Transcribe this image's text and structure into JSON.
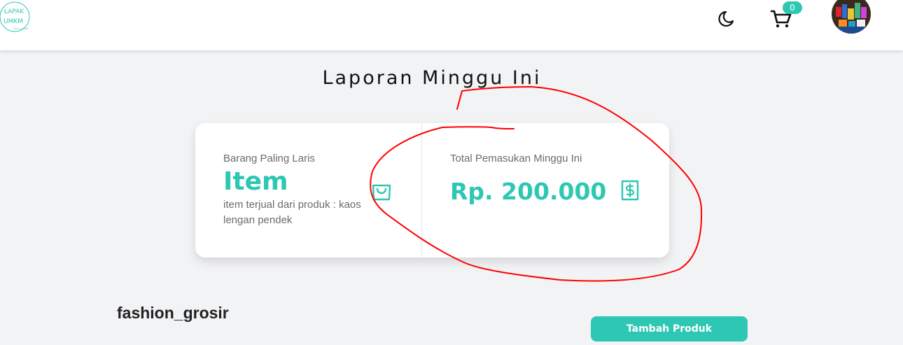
{
  "header": {
    "logo_text_line1": "LAPAK",
    "logo_text_line2": "UMKM",
    "logo_text_line3": "LOCAL STORE",
    "cart_count": "0",
    "icons": [
      "logo-icon",
      "moon-icon",
      "cart-icon",
      "avatar"
    ]
  },
  "report": {
    "title": "Laporan Minggu Ini",
    "best_seller": {
      "label": "Barang Paling Laris",
      "value": "Item",
      "description": "item terjual dari produk : kaos lengan pendek",
      "icon": "shopping-bag-icon"
    },
    "income": {
      "label": "Total Pemasukan Minggu Ini",
      "value": "Rp. 200.000",
      "icon": "dollar-receipt-icon"
    }
  },
  "store": {
    "name": "fashion_grosir",
    "add_product_label": "Tambah Produk"
  },
  "colors": {
    "accent": "#2ec7b3",
    "background": "#f2f3f5",
    "annotation": "#ff0000"
  }
}
